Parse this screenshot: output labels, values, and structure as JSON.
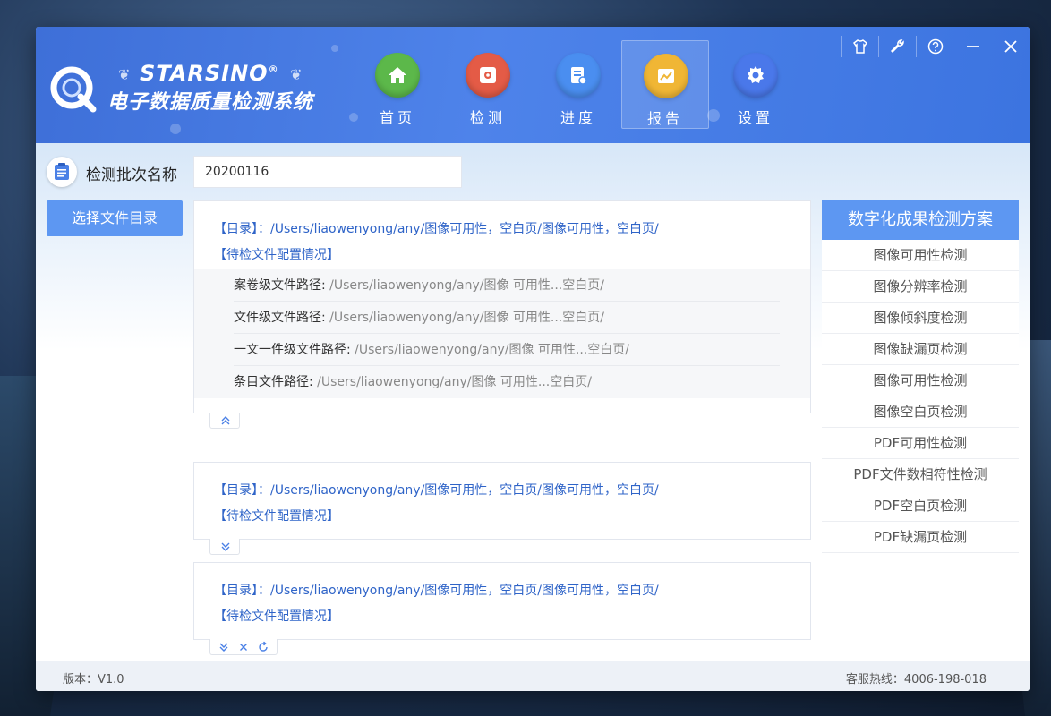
{
  "header": {
    "brand": "STARSINO",
    "brand_mark": "®",
    "subtitle": "电子数据质量检测系统"
  },
  "nav": [
    {
      "label": "首页",
      "color": "#5cb84a",
      "icon": "home-icon"
    },
    {
      "label": "检测",
      "color": "#e45b46",
      "icon": "inspect-icon"
    },
    {
      "label": "进度",
      "color": "#4a8ef0",
      "icon": "progress-icon"
    },
    {
      "label": "报告",
      "color": "#f0b635",
      "icon": "report-icon",
      "active": true
    },
    {
      "label": "设置",
      "color": "#4a78ea",
      "icon": "gear-icon"
    }
  ],
  "window_controls": [
    "skin-icon",
    "wrench-icon",
    "help-icon",
    "minimize-icon",
    "close-icon"
  ],
  "batch": {
    "label": "检测批次名称",
    "value": "20200116"
  },
  "select_button": "选择文件目录",
  "cards": [
    {
      "path_label": "【目录】：",
      "path": "/Users/liaowenyong/any/图像可用性，空白页/图像可用性，空白页/",
      "config_label": "【待检文件配置情况】",
      "details": [
        {
          "label": "案卷级文件路径: ",
          "value": "/Users/liaowenyong/any/图像 可用性...空白页/"
        },
        {
          "label": "文件级文件路径: ",
          "value": "/Users/liaowenyong/any/图像 可用性...空白页/"
        },
        {
          "label": "一文一件级文件路径: ",
          "value": "/Users/liaowenyong/any/图像 可用性...空白页/"
        },
        {
          "label": "条目文件路径: ",
          "value": "/Users/liaowenyong/any/图像 可用性...空白页/"
        }
      ]
    },
    {
      "path_label": "【目录】：",
      "path": "/Users/liaowenyong/any/图像可用性，空白页/图像可用性，空白页/",
      "config_label": "【待检文件配置情况】"
    },
    {
      "path_label": "【目录】：",
      "path": "/Users/liaowenyong/any/图像可用性，空白页/图像可用性，空白页/",
      "config_label": "【待检文件配置情况】"
    }
  ],
  "side_panel": {
    "title": "数字化成果检测方案",
    "items": [
      "图像可用性检测",
      "图像分辨率检测",
      "图像倾斜度检测",
      "图像缺漏页检测",
      "图像可用性检测",
      "图像空白页检测",
      "PDF可用性检测",
      "PDF文件数相符性检测",
      "PDF空白页检测",
      "PDF缺漏页检测"
    ]
  },
  "footer": {
    "version": "版本：V1.0",
    "hotline": "客服热线：4006-198-018"
  },
  "colors": {
    "accent": "#5d97f2",
    "header": "#4a80e6",
    "link_text": "#2f64c8"
  }
}
